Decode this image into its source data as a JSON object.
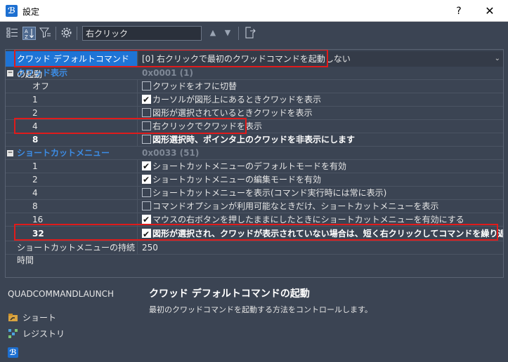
{
  "window": {
    "title": "設定",
    "help_label": "?",
    "close_label": "✕"
  },
  "toolbar": {
    "search_value": "右クリック"
  },
  "grid": {
    "selected": {
      "name": "クワッド デフォルトコマンドの起動",
      "value": "[0] 右クリックで最初のクワッドコマンドを起動しない"
    },
    "quad": {
      "category": "クワッド表示",
      "category_value": "0x0001 (1)",
      "rows": [
        {
          "name": "オフ",
          "label": "クワッドをオフに切替",
          "checked": false
        },
        {
          "name": "1",
          "label": "カーソルが図形上にあるときクワッドを表示",
          "checked": true
        },
        {
          "name": "2",
          "label": "図形が選択されているときクワッドを表示",
          "checked": false
        },
        {
          "name": "4",
          "label": "右クリックでクワッドを表示",
          "checked": false
        },
        {
          "name": "8",
          "label": "図形選択時、ポインタ上のクワッドを非表示にします",
          "checked": false
        }
      ]
    },
    "shortcut": {
      "category": "ショートカットメニュー",
      "category_value": "0x0033 (51)",
      "rows": [
        {
          "name": "1",
          "label": "ショートカットメニューのデフォルトモードを有効",
          "checked": true
        },
        {
          "name": "2",
          "label": "ショートカットメニューの編集モードを有効",
          "checked": true
        },
        {
          "name": "4",
          "label": "ショートカットメニューを表示(コマンド実行時には常に表示)",
          "checked": false
        },
        {
          "name": "8",
          "label": "コマンドオプションが利用可能なときだけ、ショートカットメニューを表示",
          "checked": false
        },
        {
          "name": "16",
          "label": "マウスの右ボタンを押したままにしたときにショートカットメニューを有効にする",
          "checked": true
        },
        {
          "name": "32",
          "label": "図形が選択され、クワッドが表示されていない場合は、短く右クリックしてコマンドを繰り返します",
          "checked": true
        }
      ]
    },
    "duration": {
      "name": "ショートカットメニューの持続時間",
      "value": "250"
    }
  },
  "bottom": {
    "variable": "QUADCOMMANDLAUNCH",
    "desc_title": "クワッド デフォルトコマンドの起動",
    "desc_text": "最初のクワッドコマンドを起動する方法をコントロールします。",
    "side_items": [
      "ショート",
      "レジストリ"
    ]
  },
  "colors": {
    "accent": "#1e74d6",
    "highlight": "#e01b1b",
    "background": "#3b4453"
  }
}
